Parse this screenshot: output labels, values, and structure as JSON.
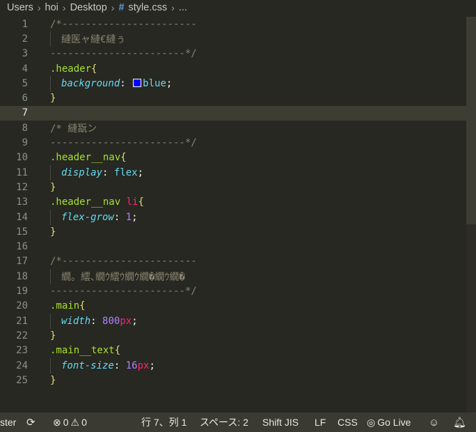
{
  "breadcrumb": {
    "items": [
      "Users",
      "hoi",
      "Desktop"
    ],
    "hash": "#",
    "file": "style.css",
    "more": "..."
  },
  "editor": {
    "current_line": 7,
    "lines": [
      {
        "n": "1"
      },
      {
        "n": "2"
      },
      {
        "n": "3"
      },
      {
        "n": "4"
      },
      {
        "n": "5"
      },
      {
        "n": "6"
      },
      {
        "n": "7"
      },
      {
        "n": "8"
      },
      {
        "n": "9"
      },
      {
        "n": "10"
      },
      {
        "n": "11"
      },
      {
        "n": "12"
      },
      {
        "n": "13"
      },
      {
        "n": "14"
      },
      {
        "n": "15"
      },
      {
        "n": "16"
      },
      {
        "n": "17"
      },
      {
        "n": "18"
      },
      {
        "n": "19"
      },
      {
        "n": "20"
      },
      {
        "n": "21"
      },
      {
        "n": "22"
      },
      {
        "n": "23"
      },
      {
        "n": "24"
      },
      {
        "n": "25"
      }
    ],
    "code": {
      "l1": "/*-----------------------",
      "l2": "縺医ャ縺€縺ぅ",
      "l3": "-----------------------*/",
      "l4_sel": ".header",
      "l5_prop": "background",
      "l5_val": "blue",
      "l8": "/* 縺翫ン",
      "l9": "-----------------------*/",
      "l10_sel": ".header__nav",
      "l11_prop": "display",
      "l11_val": "flex",
      "l13_sel": ".header__nav",
      "l13_tag": "li",
      "l14_prop": "flex-grow",
      "l14_num": "1",
      "l17": "/*-----------------------",
      "l18": "繝。繧､繝ｳ繧ｳ繝ｳ繝�繝ｳ繝�",
      "l19": "-----------------------*/",
      "l20_sel": ".main",
      "l21_prop": "width",
      "l21_num": "800",
      "l21_unit": "px",
      "l23_sel": ".main__text",
      "l24_prop": "font-size",
      "l24_num": "16",
      "l24_unit": "px",
      "open_brace": "{",
      "close_brace": "}",
      "colon": ":",
      "semicolon": ";",
      "swatch_color": "#0000ff"
    }
  },
  "statusbar": {
    "branch": "ster",
    "errors": "0",
    "warnings": "0",
    "position": "行 7、列 1",
    "spaces": "スペース: 2",
    "encoding": "Shift JIS",
    "eol": "LF",
    "language": "CSS",
    "golive": "Go Live"
  }
}
